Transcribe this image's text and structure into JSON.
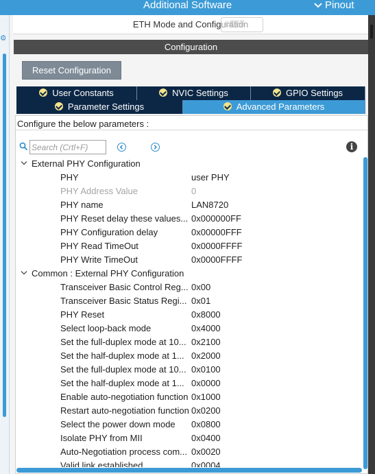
{
  "topbar": {
    "title": "Additional Software",
    "pinout": "Pinout"
  },
  "mode_header": "ETH Mode and Configuration",
  "ghost_overlay": "©翻译",
  "config_title": "Configuration",
  "reset_label": "Reset Configuration",
  "tabs_row1": [
    "User Constants",
    "NVIC Settings",
    "GPIO Settings"
  ],
  "tabs_row2": [
    "Parameter Settings",
    "Advanced Parameters"
  ],
  "active_tab": "Advanced Parameters",
  "hint": "Configure the below parameters :",
  "search": {
    "placeholder": "Search (Crtl+F)"
  },
  "groups": [
    {
      "title": "External PHY Configuration",
      "rows": [
        {
          "name": "PHY",
          "value": "user PHY"
        },
        {
          "name": "PHY Address Value",
          "value": "0"
        },
        {
          "name": "PHY name",
          "value": "LAN8720"
        },
        {
          "name": "PHY Reset delay these values...",
          "value": "0x000000FF"
        },
        {
          "name": "PHY Configuration delay",
          "value": "0x00000FFF"
        },
        {
          "name": "PHY Read TimeOut",
          "value": "0x0000FFFF"
        },
        {
          "name": "PHY Write TimeOut",
          "value": "0x0000FFFF"
        }
      ]
    },
    {
      "title": "Common : External PHY Configuration",
      "rows": [
        {
          "name": "Transceiver Basic Control Reg...",
          "value": "0x00"
        },
        {
          "name": "Transceiver Basic Status Regi...",
          "value": "0x01"
        },
        {
          "name": "PHY Reset",
          "value": "0x8000"
        },
        {
          "name": "Select loop-back mode",
          "value": "0x4000"
        },
        {
          "name": "Set the full-duplex mode at 10...",
          "value": "0x2100"
        },
        {
          "name": "Set the half-duplex mode at 1...",
          "value": "0x2000"
        },
        {
          "name": "Set the full-duplex mode at 10...",
          "value": "0x0100"
        },
        {
          "name": "Set the half-duplex mode at 1...",
          "value": "0x0000"
        },
        {
          "name": "Enable auto-negotiation function",
          "value": "0x1000"
        },
        {
          "name": "Restart auto-negotiation function",
          "value": "0x0200"
        },
        {
          "name": "Select the power down mode",
          "value": "0x0800"
        },
        {
          "name": "Isolate PHY from MII",
          "value": "0x0400"
        },
        {
          "name": "Auto-Negotiation process com...",
          "value": "0x0020"
        },
        {
          "name": "Valid link established",
          "value": "0x0004"
        }
      ]
    }
  ],
  "colors": {
    "accent": "#3c9bd6",
    "tab_dark": "#0c2746",
    "check": "#f4e38a",
    "disabled_text": "#a4a4a4"
  },
  "icons": [
    "settings-icon",
    "chevron-down-icon",
    "check-icon",
    "search-icon",
    "prev-arrow-icon",
    "next-arrow-icon",
    "info-icon"
  ]
}
